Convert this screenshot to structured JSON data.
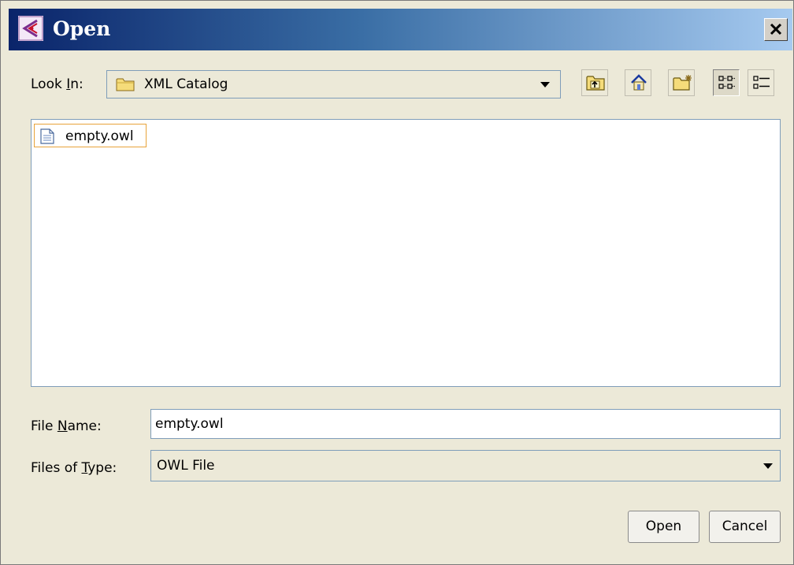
{
  "window": {
    "title": "Open"
  },
  "look_in": {
    "label_prefix": "Look ",
    "label_mnemonic": "I",
    "label_suffix": "n:",
    "value": "XML Catalog",
    "value_icon": "folder-icon"
  },
  "toolbar": {
    "icons": [
      "up-folder-icon",
      "home-icon",
      "new-folder-icon",
      "list-view-icon",
      "details-view-icon"
    ],
    "selected_view": "list-view"
  },
  "files": [
    {
      "name": "empty.owl",
      "icon": "document-icon",
      "selected": true
    }
  ],
  "file_name": {
    "label_prefix": "File ",
    "label_mnemonic": "N",
    "label_suffix": "ame:",
    "value": "empty.owl"
  },
  "file_type": {
    "label_prefix": "Files of ",
    "label_mnemonic": "T",
    "label_suffix": "ype:",
    "value": "OWL File"
  },
  "buttons": {
    "open": "Open",
    "cancel": "Cancel"
  },
  "colors": {
    "selection_border": "#e8a33a",
    "titlebar_start": "#0a246a",
    "titlebar_end": "#a6caf0"
  }
}
